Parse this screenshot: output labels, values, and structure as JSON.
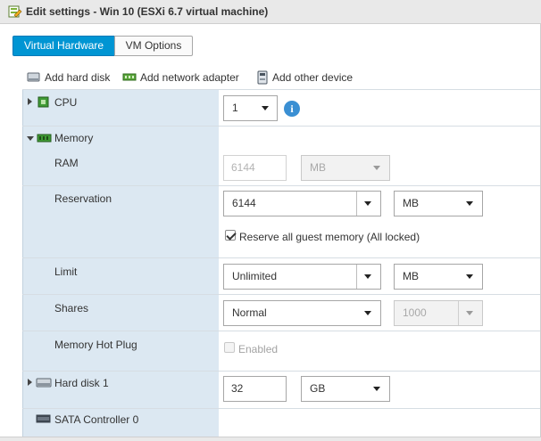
{
  "window": {
    "title": "Edit settings - Win 10 (ESXi 6.7 virtual machine)"
  },
  "tabs": [
    {
      "label": "Virtual Hardware",
      "active": true
    },
    {
      "label": "VM Options",
      "active": false
    }
  ],
  "toolbar": {
    "add_hard_disk": "Add hard disk",
    "add_network_adapter": "Add network adapter",
    "add_other_device": "Add other device"
  },
  "hardware": {
    "cpu": {
      "label": "CPU",
      "value": "1"
    },
    "memory": {
      "label": "Memory",
      "ram": {
        "label": "RAM",
        "value": "6144",
        "unit": "MB"
      },
      "reservation": {
        "label": "Reservation",
        "value": "6144",
        "unit": "MB",
        "reserve_all_label": "Reserve all guest memory (All locked)",
        "reserve_all_checked": true
      },
      "limit": {
        "label": "Limit",
        "value": "Unlimited",
        "unit": "MB"
      },
      "shares": {
        "label": "Shares",
        "value": "Normal",
        "number": "1000"
      },
      "hot_plug": {
        "label": "Memory Hot Plug",
        "checkbox_label": "Enabled",
        "checked": false
      }
    },
    "hard_disk_1": {
      "label": "Hard disk 1",
      "value": "32",
      "unit": "GB"
    },
    "sata_controller": {
      "label": "SATA Controller 0"
    }
  },
  "colors": {
    "accent": "#0095d3",
    "label_column": "#dce8f2",
    "info_icon": "#3a8fd3"
  }
}
